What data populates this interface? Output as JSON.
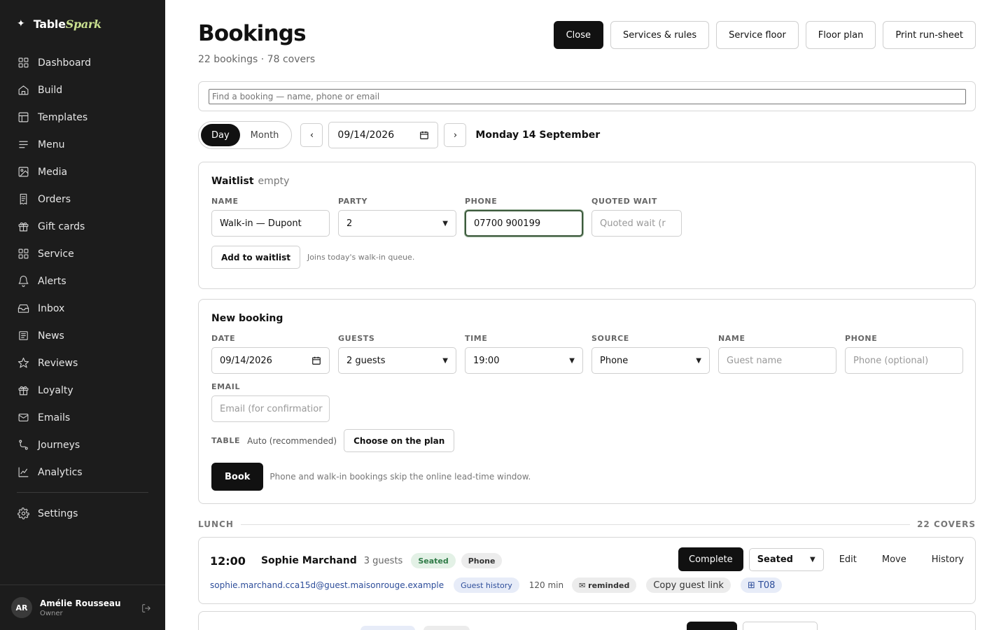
{
  "app": {
    "brand_prefix": "Table",
    "brand_suffix": "Spark"
  },
  "sidebar": {
    "items": [
      {
        "label": "Dashboard",
        "icon": "grid-icon"
      },
      {
        "label": "Build",
        "icon": "home-icon"
      },
      {
        "label": "Templates",
        "icon": "layout-icon"
      },
      {
        "label": "Menu",
        "icon": "list-icon"
      },
      {
        "label": "Media",
        "icon": "image-icon"
      },
      {
        "label": "Orders",
        "icon": "receipt-icon"
      },
      {
        "label": "Gift cards",
        "icon": "gift-icon"
      },
      {
        "label": "Service",
        "icon": "grid-icon"
      },
      {
        "label": "Alerts",
        "icon": "bell-icon"
      },
      {
        "label": "Inbox",
        "icon": "inbox-icon"
      },
      {
        "label": "News",
        "icon": "newspaper-icon"
      },
      {
        "label": "Reviews",
        "icon": "star-icon"
      },
      {
        "label": "Loyalty",
        "icon": "gift-icon"
      },
      {
        "label": "Emails",
        "icon": "mail-icon"
      },
      {
        "label": "Journeys",
        "icon": "route-icon"
      },
      {
        "label": "Analytics",
        "icon": "chart-icon"
      }
    ],
    "settings": "Settings",
    "user": {
      "initials": "AR",
      "name": "Amélie Rousseau",
      "role": "Owner"
    }
  },
  "header": {
    "title": "Bookings",
    "subtitle": "22 bookings · 78 covers",
    "actions": {
      "close": "Close",
      "services": "Services & rules",
      "floor": "Service floor",
      "plan": "Floor plan",
      "print": "Print run-sheet"
    }
  },
  "search": {
    "placeholder": "Find a booking — name, phone or email"
  },
  "date_nav": {
    "day": "Day",
    "month": "Month",
    "prev": "‹",
    "next": "›",
    "date_value": "09/14/2026",
    "date_label": "Monday 14 September"
  },
  "waitlist": {
    "title": "Waitlist",
    "status": "empty",
    "name_label": "Name",
    "name_value": "Walk-in — Dupont",
    "party_label": "Party",
    "party_value": "2",
    "phone_label": "Phone",
    "phone_value": "07700 900199",
    "wait_label": "Quoted wait",
    "wait_placeholder": "Quoted wait (r",
    "add_button": "Add to waitlist",
    "hint": "Joins today's walk-in queue."
  },
  "new_booking": {
    "title": "New booking",
    "date_label": "Date",
    "date_value": "09/14/2026",
    "guests_label": "Guests",
    "guests_value": "2 guests",
    "time_label": "Time",
    "time_value": "19:00",
    "source_label": "Source",
    "source_value": "Phone",
    "name_label": "Name",
    "name_placeholder": "Guest name",
    "phone_label": "Phone",
    "phone_placeholder": "Phone (optional)",
    "email_label": "Email",
    "email_placeholder": "Email (for confirmatior",
    "table_label": "Table",
    "table_value": "Auto (recommended)",
    "choose_plan": "Choose on the plan",
    "book_button": "Book",
    "book_hint": "Phone and walk-in bookings skip the online lead-time window."
  },
  "section": {
    "label": "LUNCH",
    "covers": "22 COVERS"
  },
  "booking": {
    "time": "12:00",
    "name": "Sophie Marchand",
    "guests": "3 guests",
    "status_badge": "Seated",
    "source_badge": "Phone",
    "email": "sophie.marchand.cca15d@guest.maisonrouge.example",
    "guest_history": "Guest history",
    "duration": "120 min",
    "reminded": "✉ reminded",
    "copy_link": "Copy guest link",
    "table": "⊞ T08",
    "complete": "Complete",
    "status_select": "Seated",
    "edit": "Edit",
    "move": "Move",
    "history": "History"
  }
}
